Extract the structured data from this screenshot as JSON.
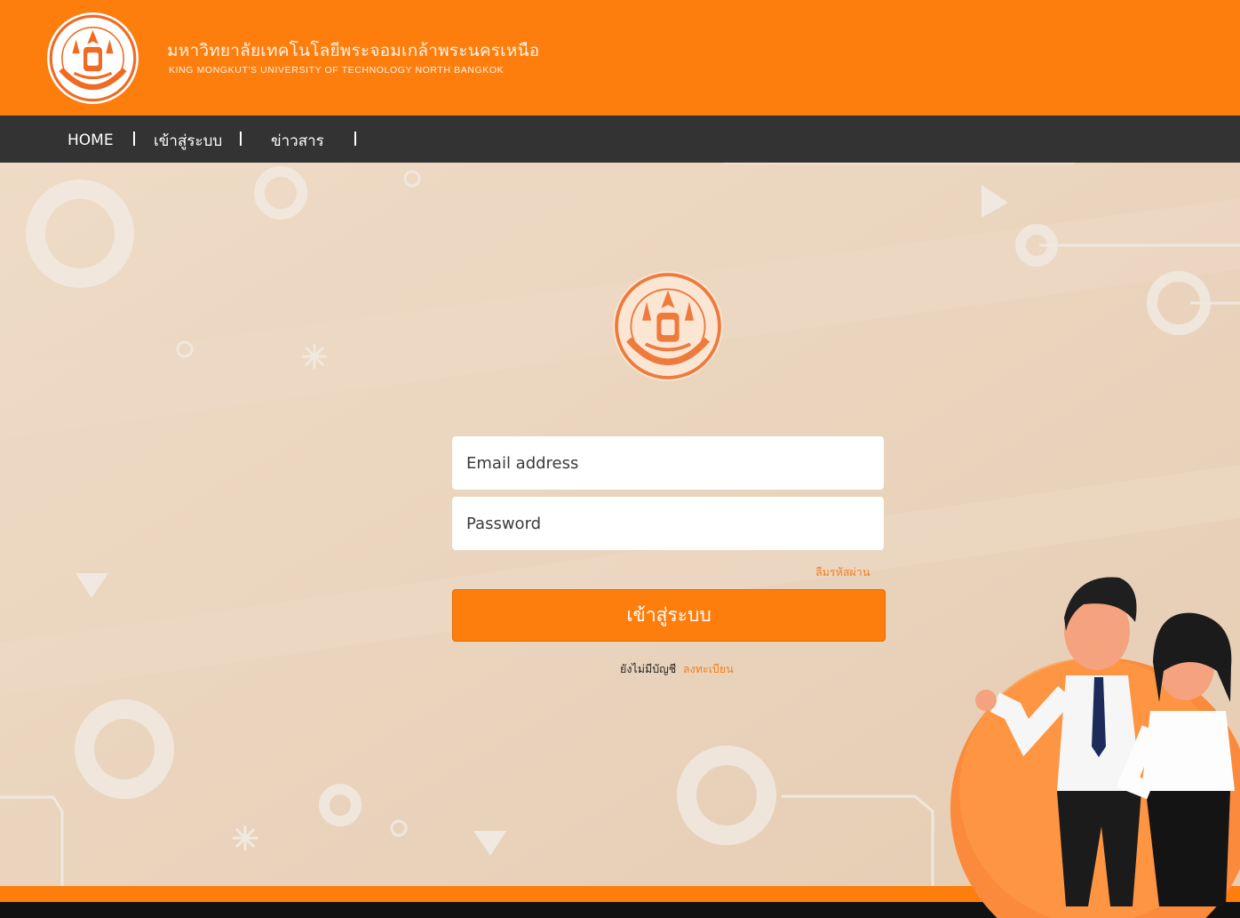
{
  "header": {
    "title": "มหาวิทยาลัยเทคโนโลยีพระจอมเกล้าพระนครเหนือ",
    "subtitle": "KING MONGKUT'S UNIVERSITY OF TECHNOLOGY NORTH BANGKOK",
    "logo_icon": "university-seal-icon"
  },
  "nav": {
    "items": [
      {
        "label": "HOME"
      },
      {
        "label": "เข้าสู่ระบบ"
      },
      {
        "label": "ข่าวสาร"
      }
    ]
  },
  "login": {
    "email_placeholder": "Email address",
    "password_placeholder": "Password",
    "forgot_label": "ลืมรหัสผ่าน",
    "submit_label": "เข้าสู่ระบบ",
    "no_account_text": "ยังไม่มีบัญชี",
    "register_label": "ลงทะเบียน"
  },
  "colors": {
    "brand_orange": "#fd7e0d",
    "nav_dark": "#333333",
    "background": "#e8d2bb",
    "link_orange": "#f47e20"
  }
}
